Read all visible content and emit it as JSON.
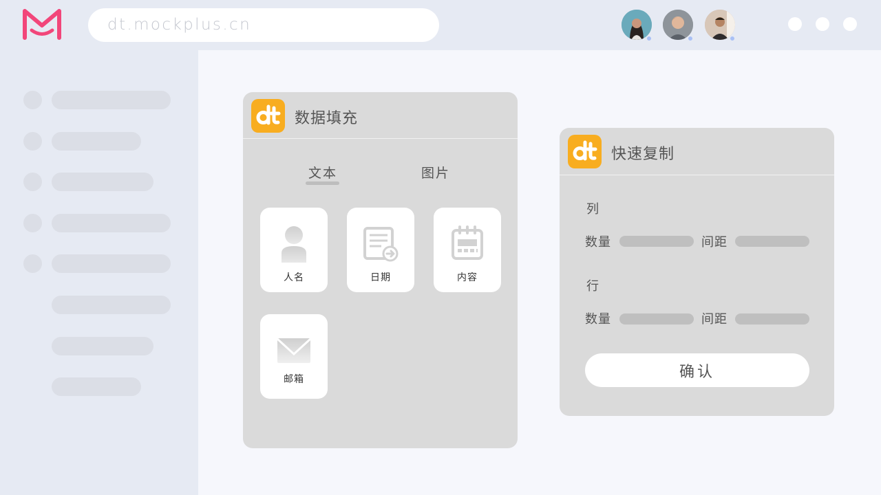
{
  "browser": {
    "url": "dt.mockplus.cn",
    "brand_color": "#f2467a",
    "avatars": [
      {
        "name": "avatar-1",
        "bg": "#5b8fa0"
      },
      {
        "name": "avatar-2",
        "bg": "#8a8f96"
      },
      {
        "name": "avatar-3",
        "bg": "#c9b7a9"
      }
    ]
  },
  "data_fill_panel": {
    "badge": "dt",
    "title": "数据填充",
    "tabs": [
      {
        "label": "文本",
        "active": true
      },
      {
        "label": "图片",
        "active": false
      }
    ],
    "tiles": [
      {
        "label": "人名",
        "icon": "person-icon"
      },
      {
        "label": "日期",
        "icon": "date-document-icon"
      },
      {
        "label": "内容",
        "icon": "calendar-icon"
      },
      {
        "label": "邮箱",
        "icon": "mail-icon"
      }
    ]
  },
  "quick_copy_panel": {
    "badge": "dt",
    "title": "快速复制",
    "column_section": {
      "label": "列",
      "count_label": "数量",
      "spacing_label": "间距"
    },
    "row_section": {
      "label": "行",
      "count_label": "数量",
      "spacing_label": "间距"
    },
    "confirm_label": "确认"
  },
  "colors": {
    "accent": "#f8ad20",
    "panel_bg": "#dadada",
    "sidebar_bg": "#e6eaf3"
  }
}
